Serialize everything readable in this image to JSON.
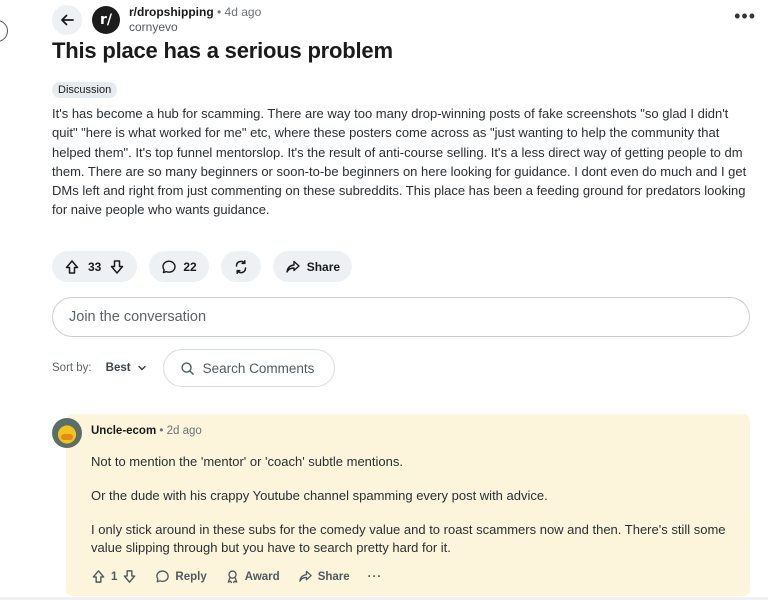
{
  "post": {
    "subreddit": "r/dropshipping",
    "subreddit_avatar_text": "r/",
    "separator": "•",
    "time_ago": "4d ago",
    "author": "cornyevo",
    "more": "•••",
    "title": "This place has a serious problem",
    "flair": "Discussion",
    "body": "It's has become a hub for scamming. There are way too many drop-winning posts of fake screenshots \"so glad I didn't quit\" \"here is what worked for me\" etc, where these posters come across as \"just wanting to help the community that helped them\". It's top funnel mentorslop. It's the result of anti-course selling. It's a less direct way of getting people to dm them. There are so many beginners or soon-to-be beginners on here looking for guidance. I dont even do much and I get DMs left and right from just commenting on these subreddits. This place has been a feeding ground for predators looking for naive people who wants guidance.",
    "actions": {
      "votes": "33",
      "comments": "22",
      "share": "Share"
    }
  },
  "join": {
    "placeholder": "Join the conversation"
  },
  "sort": {
    "label": "Sort by:",
    "value": "Best",
    "search_placeholder": "Search Comments"
  },
  "comment": {
    "author": "Uncle-ecom",
    "separator": "•",
    "time_ago": "2d ago",
    "paragraphs": [
      "Not to mention the 'mentor' or 'coach' subtle mentions.",
      "Or the dude with his crappy Youtube channel spamming every post with advice.",
      "I only stick around in these subs for the comedy value and to roast scammers now and then. There's still some value slipping through but you have to search pretty hard for it."
    ],
    "actions": {
      "votes": "1",
      "reply": "Reply",
      "award": "Award",
      "share": "Share",
      "more": "···"
    }
  },
  "colors": {
    "comment_highlight": "#fcf5dc",
    "pill_bg": "#eef1f3",
    "text": "#1a1a1b"
  },
  "icons": [
    "back-arrow-icon",
    "upvote-icon",
    "downvote-icon",
    "comment-icon",
    "repost-icon",
    "share-icon",
    "search-icon",
    "chevron-down-icon",
    "award-icon",
    "reply-icon"
  ]
}
